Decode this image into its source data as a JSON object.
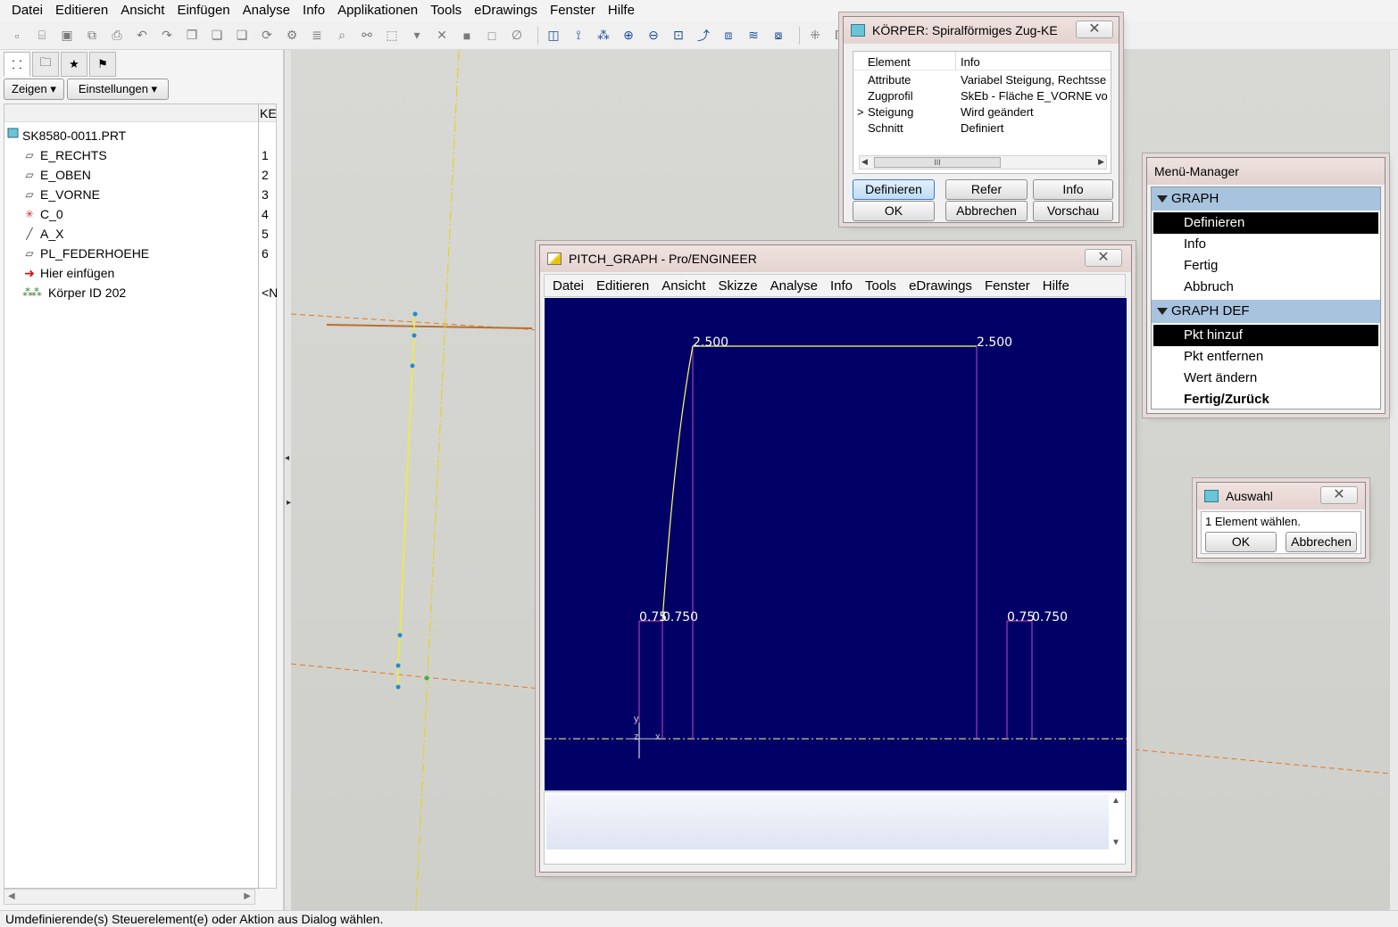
{
  "menubar": [
    "Datei",
    "Editieren",
    "Ansicht",
    "Einfügen",
    "Analyse",
    "Info",
    "Applikationen",
    "Tools",
    "eDrawings",
    "Fenster",
    "Hilfe"
  ],
  "left_panel": {
    "buttons": {
      "show": "Zeigen ▾",
      "settings": "Einstellungen ▾"
    },
    "column_header": "KE",
    "root": "SK8580-0011.PRT",
    "items": [
      {
        "label": "E_RECHTS",
        "num": "1",
        "icon": "datum-plane-icon"
      },
      {
        "label": "E_OBEN",
        "num": "2",
        "icon": "datum-plane-icon"
      },
      {
        "label": "E_VORNE",
        "num": "3",
        "icon": "datum-plane-icon"
      },
      {
        "label": "C_0",
        "num": "4",
        "icon": "coordinate-system-icon"
      },
      {
        "label": "A_X",
        "num": "5",
        "icon": "datum-axis-icon"
      },
      {
        "label": "PL_FEDERHOEHE",
        "num": "6",
        "icon": "datum-plane-icon"
      },
      {
        "label": "Hier einfügen",
        "num": "",
        "icon": "insert-here-arrow-icon"
      },
      {
        "label": "Körper ID 202",
        "num": "<N",
        "icon": "helical-sweep-icon"
      }
    ]
  },
  "koerper_dialog": {
    "title": "KÖRPER: Spiralförmiges Zug-KE",
    "headers": {
      "element": "Element",
      "info": "Info"
    },
    "rows": [
      {
        "marker": "",
        "element": "Attribute",
        "info": "Variabel Steigung, Rechtsse"
      },
      {
        "marker": "",
        "element": "Zugprofil",
        "info": "SkEb - Fläche E_VORNE  vo"
      },
      {
        "marker": ">",
        "element": "Steigung",
        "info": "Wird geändert"
      },
      {
        "marker": "",
        "element": "Schnitt",
        "info": "Definiert"
      }
    ],
    "scroll_thumb": "III",
    "buttons": {
      "define": "Definieren",
      "refer": "Refer",
      "info": "Info",
      "ok": "OK",
      "cancel": "Abbrechen",
      "preview": "Vorschau"
    }
  },
  "menu_manager": {
    "title": "Menü-Manager",
    "sections": [
      {
        "header": "GRAPH",
        "items": [
          "Definieren",
          "Info",
          "Fertig",
          "Abbruch"
        ],
        "selected": "Definieren"
      },
      {
        "header": "GRAPH DEF",
        "items": [
          "Pkt hinzuf",
          "Pkt entfernen",
          "Wert ändern",
          "Fertig/Zurück"
        ],
        "selected": "Pkt hinzuf"
      }
    ]
  },
  "pitch_graph": {
    "title": "PITCH_GRAPH - Pro/ENGINEER",
    "menu": [
      "Datei",
      "Editieren",
      "Ansicht",
      "Skizze",
      "Analyse",
      "Info",
      "Tools",
      "eDrawings",
      "Fenster",
      "Hilfe"
    ],
    "dimension_labels": [
      "2.500",
      "2.500",
      "0.75",
      "0.750",
      "0.75",
      "0.750"
    ],
    "axis_labels": {
      "y": "y",
      "z": "z",
      "x": "x"
    },
    "colors": {
      "background": "#000066",
      "curve": "#ffff66",
      "dims": "#cc44cc",
      "centerline": "#ffff88",
      "text": "#ffffff"
    }
  },
  "auswahl_dialog": {
    "title": "Auswahl",
    "message": "1 Element wählen.",
    "buttons": {
      "ok": "OK",
      "cancel": "Abbrechen"
    }
  },
  "statusbar": "Umdefinierende(s) Steuerelement(e) oder Aktion aus Dialog wählen."
}
